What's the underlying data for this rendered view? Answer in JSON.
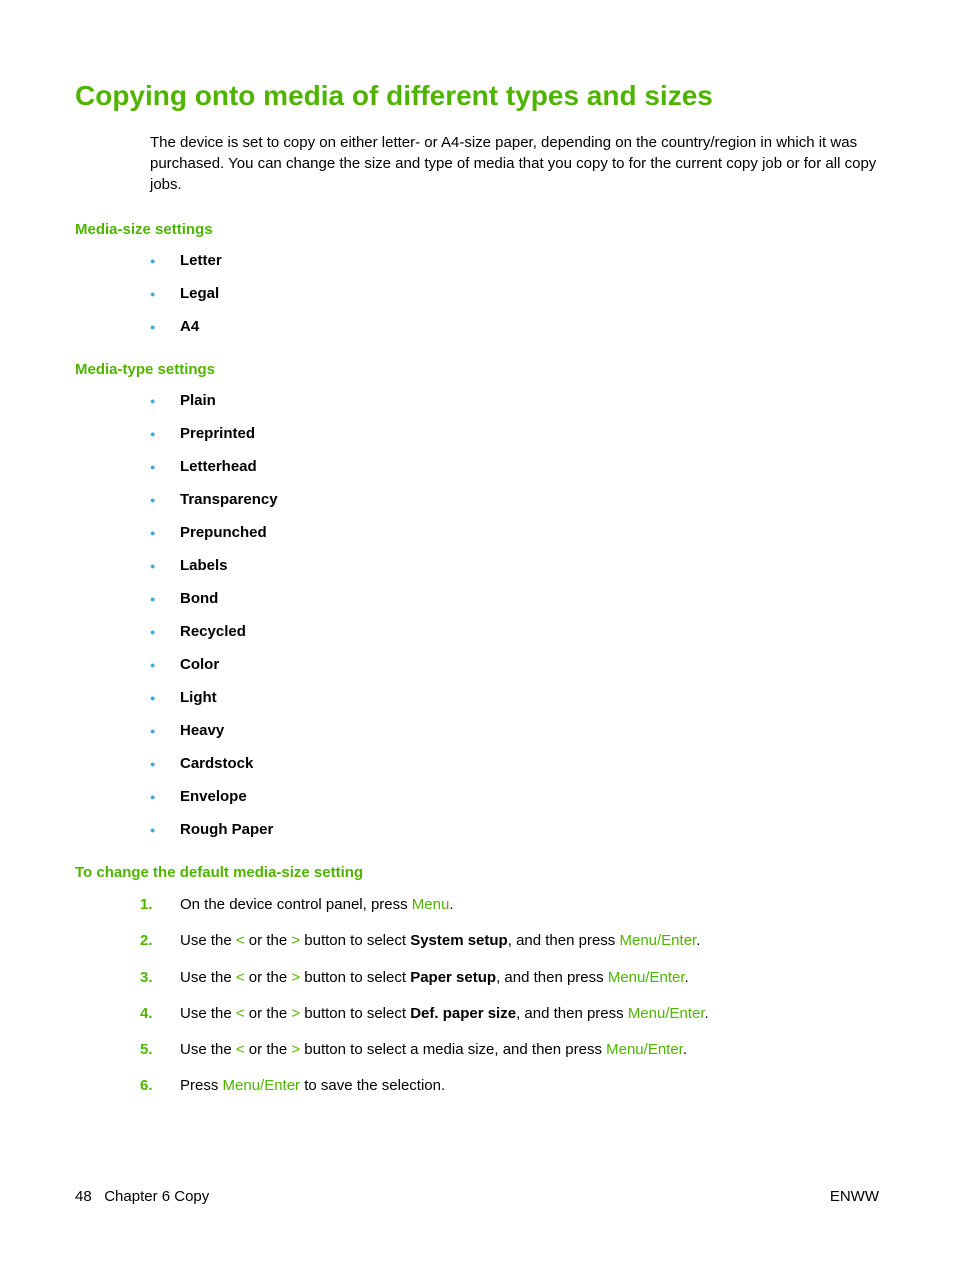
{
  "title": "Copying onto media of different types and sizes",
  "intro": "The device is set to copy on either letter- or A4-size paper, depending on the country/region in which it was purchased. You can change the size and type of media that you copy to for the current copy job or for all copy jobs.",
  "section1_heading": "Media-size settings",
  "media_sizes": [
    "Letter",
    "Legal",
    "A4"
  ],
  "section2_heading": "Media-type settings",
  "media_types": [
    "Plain",
    "Preprinted",
    "Letterhead",
    "Transparency",
    "Prepunched",
    "Labels",
    "Bond",
    "Recycled",
    "Color",
    "Light",
    "Heavy",
    "Cardstock",
    "Envelope",
    "Rough Paper"
  ],
  "section3_heading": "To change the default media-size setting",
  "steps": {
    "s1": {
      "num": "1.",
      "t0": "On the device control panel, press ",
      "menu": "Menu",
      "t1": "."
    },
    "s2": {
      "num": "2.",
      "t0": "Use the ",
      "lt": "<",
      "t1": " or the ",
      "gt": ">",
      "t2": " button to select ",
      "bold": "System setup",
      "t3": ", and then press ",
      "me": "Menu/Enter",
      "t4": "."
    },
    "s3": {
      "num": "3.",
      "t0": "Use the ",
      "lt": "<",
      "t1": " or the ",
      "gt": ">",
      "t2": " button to select ",
      "bold": "Paper setup",
      "t3": ", and then press ",
      "me": "Menu/Enter",
      "t4": "."
    },
    "s4": {
      "num": "4.",
      "t0": "Use the ",
      "lt": "<",
      "t1": " or the ",
      "gt": ">",
      "t2": " button to select ",
      "bold": "Def. paper size",
      "t3": ", and then press ",
      "me": "Menu/Enter",
      "t4": "."
    },
    "s5": {
      "num": "5.",
      "t0": "Use the ",
      "lt": "<",
      "t1": " or the ",
      "gt": ">",
      "t2": " button to select a media size, and then press ",
      "me": "Menu/Enter",
      "t3": "."
    },
    "s6": {
      "num": "6.",
      "t0": "Press ",
      "me": "Menu/Enter",
      "t1": " to save the selection."
    }
  },
  "footer": {
    "page": "48",
    "chapter": "Chapter 6   Copy",
    "right": "ENWW"
  }
}
